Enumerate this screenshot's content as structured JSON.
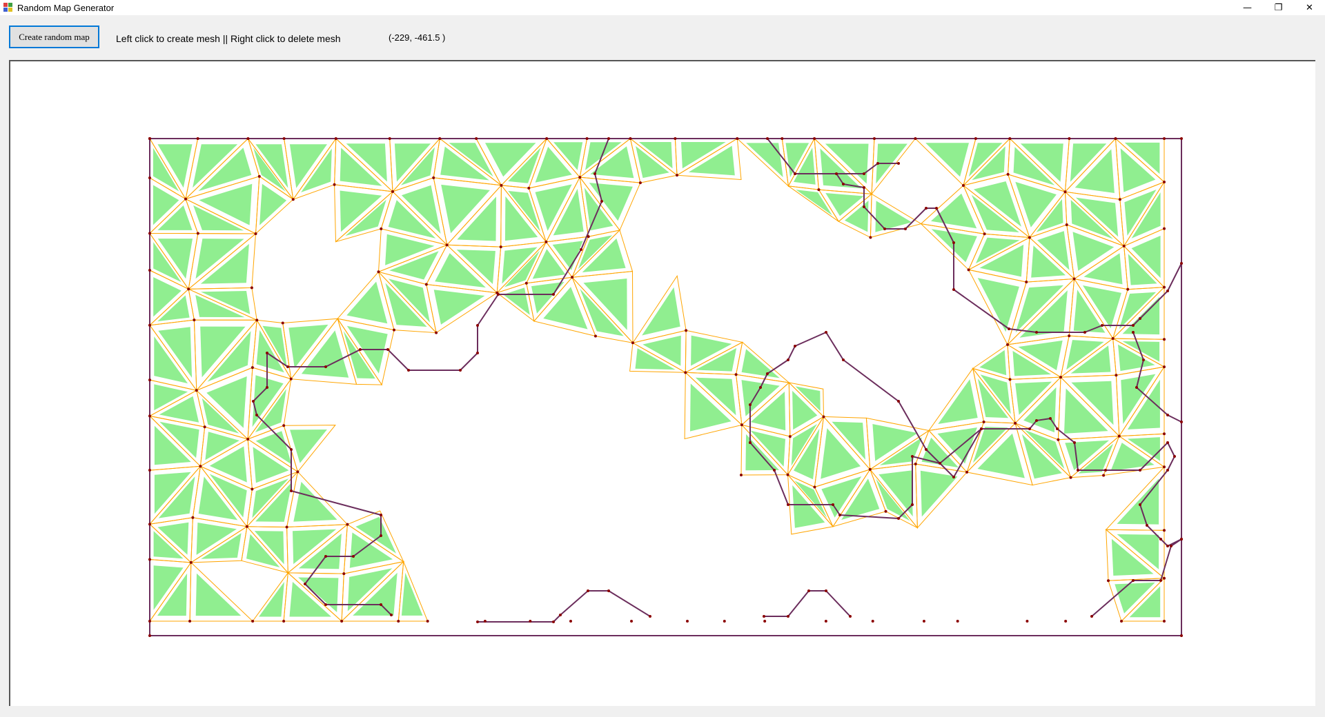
{
  "window": {
    "title": "Random Map Generator",
    "minimize_glyph": "—",
    "maximize_glyph": "❐",
    "close_glyph": "✕"
  },
  "toolbar": {
    "create_label": "Create random map",
    "instructions": "Left click to create mesh || Right click to delete mesh",
    "coordinates": "(-229, -461.5 )"
  },
  "colors": {
    "fill": "#90ee90",
    "edge": "#ffa500",
    "boundary": "#6b2d5c",
    "vertex": "#8b0000"
  }
}
